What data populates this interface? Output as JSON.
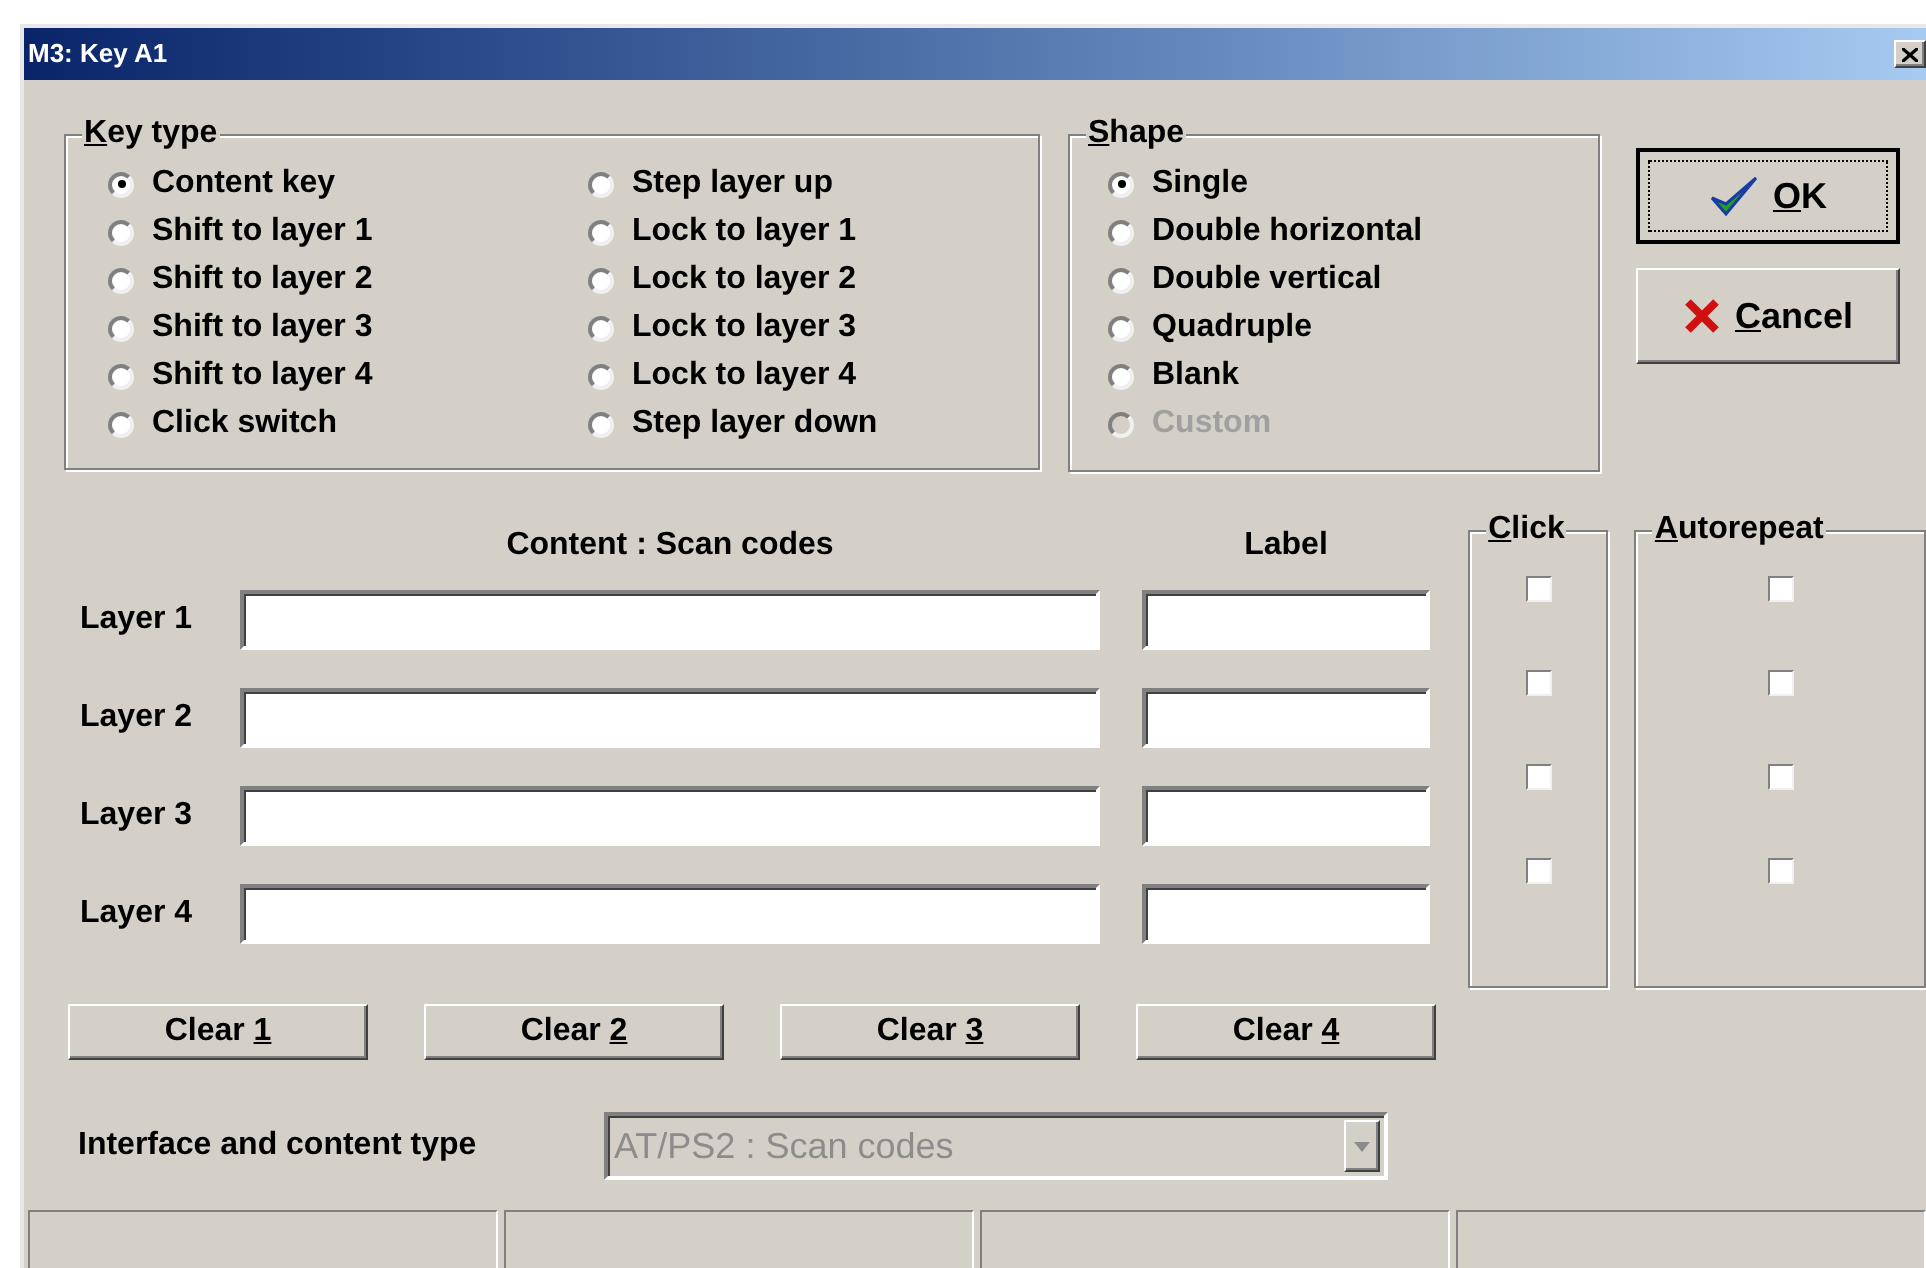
{
  "window": {
    "title": "M3: Key A1"
  },
  "key_type": {
    "title": "Key type",
    "options": [
      {
        "label": "Content key",
        "selected": true
      },
      {
        "label": "Shift to layer 1",
        "selected": false
      },
      {
        "label": "Shift to layer 2",
        "selected": false
      },
      {
        "label": "Shift to layer 3",
        "selected": false
      },
      {
        "label": "Shift to layer 4",
        "selected": false
      },
      {
        "label": "Click switch",
        "selected": false
      },
      {
        "label": "Step layer up",
        "selected": false
      },
      {
        "label": "Lock to layer 1",
        "selected": false
      },
      {
        "label": "Lock to layer 2",
        "selected": false
      },
      {
        "label": "Lock to layer 3",
        "selected": false
      },
      {
        "label": "Lock to layer 4",
        "selected": false
      },
      {
        "label": "Step layer down",
        "selected": false
      }
    ]
  },
  "shape": {
    "title": "Shape",
    "options": [
      {
        "label": "Single",
        "selected": true,
        "disabled": false
      },
      {
        "label": "Double horizontal",
        "selected": false,
        "disabled": false
      },
      {
        "label": "Double vertical",
        "selected": false,
        "disabled": false
      },
      {
        "label": "Quadruple",
        "selected": false,
        "disabled": false
      },
      {
        "label": "Blank",
        "selected": false,
        "disabled": false
      },
      {
        "label": "Custom",
        "selected": false,
        "disabled": true
      }
    ]
  },
  "buttons": [
    {
      "label": "OK",
      "kind": "ok",
      "default": true
    },
    {
      "label": "Cancel",
      "kind": "cancel",
      "default": false
    }
  ],
  "content_header": "Content : Scan codes",
  "label_header": "Label",
  "click_title": "Click",
  "autorepeat_title": "Autorepeat",
  "layers": [
    {
      "name": "Layer 1",
      "click": false,
      "autorepeat": false
    },
    {
      "name": "Layer 2",
      "click": false,
      "autorepeat": false
    },
    {
      "name": "Layer 3",
      "click": false,
      "autorepeat": false
    },
    {
      "name": "Layer 4",
      "click": false,
      "autorepeat": false
    }
  ],
  "clear_buttons": [
    "Clear 1",
    "Clear 2",
    "Clear 3",
    "Clear 4"
  ],
  "interface": {
    "label": "Interface and content type",
    "value": "AT/PS2 : Scan codes",
    "disabled": true
  }
}
